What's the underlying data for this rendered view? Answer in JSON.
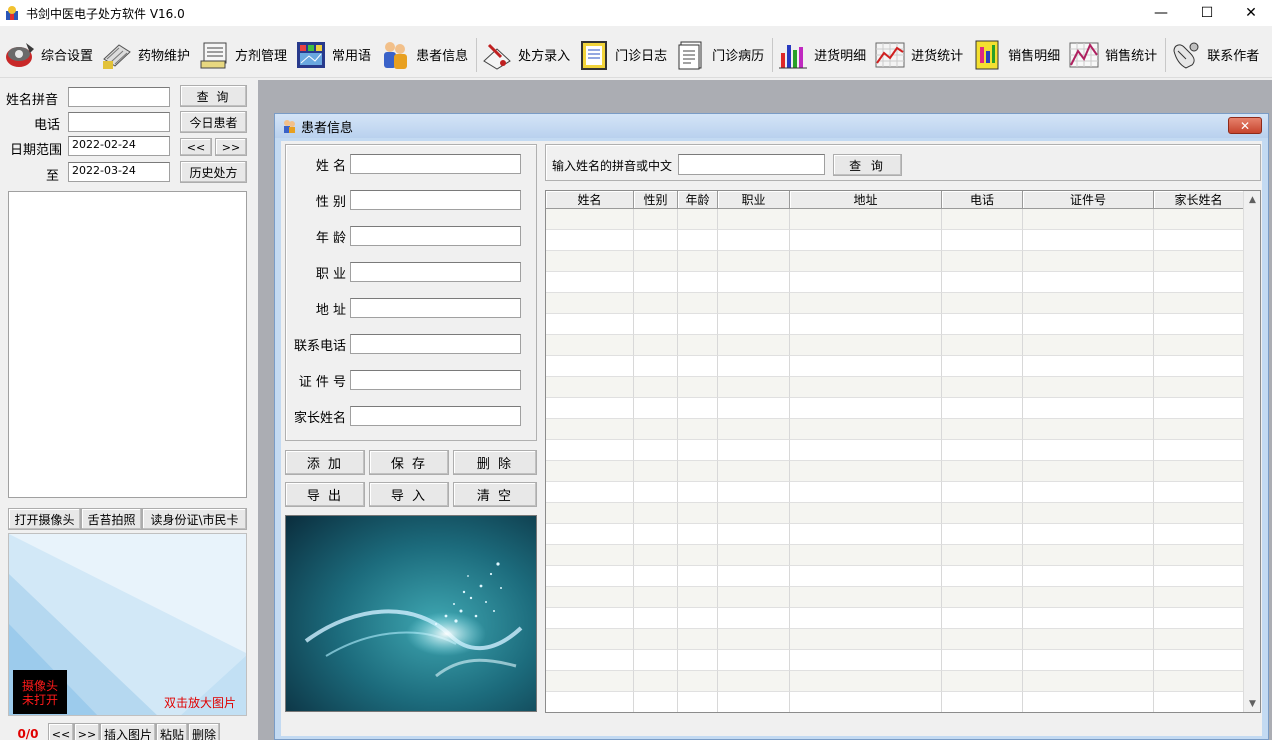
{
  "window": {
    "title": "书剑中医电子处方软件    V16.0",
    "minimize": "—",
    "maximize": "☐",
    "close": "✕"
  },
  "toolbar": [
    {
      "label": "综合设置",
      "icon": "settings-icon"
    },
    {
      "label": "药物维护",
      "icon": "medicine-icon"
    },
    {
      "label": "方剂管理",
      "icon": "formula-icon"
    },
    {
      "label": "常用语",
      "icon": "phrase-icon"
    },
    {
      "label": "患者信息",
      "icon": "patient-icon"
    },
    {
      "label": "处方录入",
      "icon": "prescription-icon"
    },
    {
      "label": "门诊日志",
      "icon": "log-icon"
    },
    {
      "label": "门诊病历",
      "icon": "record-icon"
    },
    {
      "label": "进货明细",
      "icon": "purchase-detail-icon"
    },
    {
      "label": "进货统计",
      "icon": "purchase-stats-icon"
    },
    {
      "label": "销售明细",
      "icon": "sales-detail-icon"
    },
    {
      "label": "销售统计",
      "icon": "sales-stats-icon"
    },
    {
      "label": "联系作者",
      "icon": "contact-icon"
    }
  ],
  "left": {
    "pinyin_label": "姓名拼音",
    "pinyin_value": "",
    "phone_label": "电话",
    "phone_value": "",
    "date_range_label": "日期范围",
    "date_from": "2022-02-24",
    "to_label": "至",
    "date_to": "2022-03-24",
    "query_btn": "查  询",
    "today_btn": "今日患者",
    "prev_btn": "<<",
    "next_btn": ">>",
    "history_btn": "历史处方",
    "open_camera_btn": "打开摄像头",
    "tongue_photo_btn": "舌苔拍照",
    "read_id_btn": "读身份证\\市民卡",
    "camera_status_line1": "摄像头",
    "camera_status_line2": "未打开",
    "zoom_hint": "双击放大图片",
    "photo_count": "0/0",
    "pager_prev": "<<",
    "pager_next": ">>",
    "insert_image_btn": "插入图片",
    "paste_btn": "粘贴",
    "delete_btn": "删除"
  },
  "patient_window": {
    "title": "患者信息",
    "close": "✕",
    "form": [
      {
        "key": "name",
        "label": "姓  名",
        "value": ""
      },
      {
        "key": "gender",
        "label": "性  别",
        "value": ""
      },
      {
        "key": "age",
        "label": "年  龄",
        "value": ""
      },
      {
        "key": "job",
        "label": "职  业",
        "value": ""
      },
      {
        "key": "address",
        "label": "地  址",
        "value": ""
      },
      {
        "key": "phone",
        "label": "联系电话",
        "value": ""
      },
      {
        "key": "id_number",
        "label": "证 件 号",
        "value": ""
      },
      {
        "key": "guardian",
        "label": "家长姓名",
        "value": ""
      }
    ],
    "buttons": {
      "add": "添 加",
      "save": "保 存",
      "delete": "删 除",
      "export": "导 出",
      "import": "导 入",
      "clear": "清 空"
    },
    "search": {
      "label": "输入姓名的拼音或中文",
      "value": "",
      "button": "查 询"
    },
    "table": {
      "columns": [
        "姓名",
        "性别",
        "年龄",
        "职业",
        "地址",
        "电话",
        "证件号",
        "家长姓名"
      ],
      "rows": []
    }
  }
}
